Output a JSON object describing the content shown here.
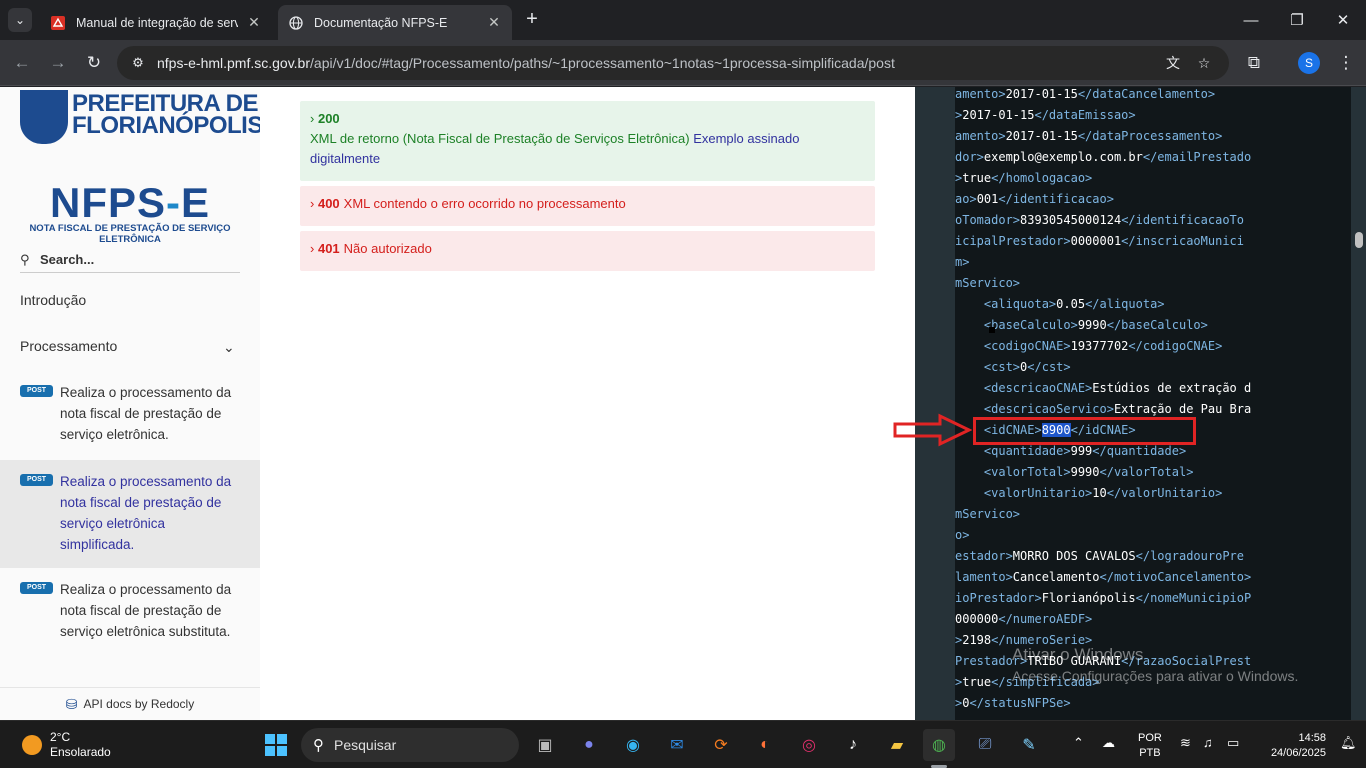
{
  "browser": {
    "tabs": [
      {
        "title": "Manual de integração de serviço",
        "icon": "pdf-icon"
      },
      {
        "title": "Documentação NFPS-E",
        "icon": "globe-icon"
      }
    ],
    "url_host": "nfps-e-hml.pmf.sc.gov.br",
    "url_path": "/api/v1/doc/#tag/Processamento/paths/~1processamento~1notas~1processa-simplificada/post",
    "profile_initial": "S"
  },
  "sidebar": {
    "logo_line1": "PREFEITURA DE",
    "logo_line2": "FLORIANÓPOLIS",
    "brand_a": "NFPS",
    "brand_dash": "-",
    "brand_b": "E",
    "brand_sub": "NOTA FISCAL DE PRESTAÇÃO DE SERVIÇO ELETRÔNICA",
    "search_placeholder": "Search...",
    "menu": [
      "Introdução",
      "Processamento"
    ],
    "operations": [
      {
        "method": "POST",
        "label": "Realiza o processamento da nota fiscal de prestação de serviço eletrônica."
      },
      {
        "method": "POST",
        "label": "Realiza o processamento da nota fiscal de prestação de serviço eletrônica simplificada."
      },
      {
        "method": "POST",
        "label": "Realiza o processamento da nota fiscal de prestação de serviço eletrônica substituta."
      }
    ],
    "footer": "API docs by Redocly"
  },
  "responses": [
    {
      "code": "200",
      "desc": "XML de retorno (Nota Fiscal de Prestação de Serviços Eletrônica)",
      "link": "Exemplo assinado digitalmente"
    },
    {
      "code": "400",
      "desc": "XML contendo o erro ocorrido no processamento"
    },
    {
      "code": "401",
      "desc": "Não autorizado"
    }
  ],
  "code_lines": [
    {
      "open": "amento>",
      "val": "2017-01-15",
      "close": "</dataCancelamento>"
    },
    {
      "open": ">",
      "val": "2017-01-15",
      "close": "</dataEmissao>"
    },
    {
      "open": "amento>",
      "val": "2017-01-15",
      "close": "</dataProcessamento>"
    },
    {
      "open": "dor>",
      "val": "exemplo@exemplo.com.br",
      "close": "</emailPrestado"
    },
    {
      "open": ">",
      "val": "true",
      "close": "</homologacao>"
    },
    {
      "open": "ao>",
      "val": "001",
      "close": "</identificacao>"
    },
    {
      "open": "oTomador>",
      "val": "83930545000124",
      "close": "</identificacaoTo"
    },
    {
      "open": "icipalPrestador>",
      "val": "0000001",
      "close": "</inscricaoMunici"
    },
    {
      "open": "m>",
      "val": "",
      "close": ""
    },
    {
      "open": "mServico>",
      "val": "",
      "close": ""
    },
    {
      "open": "    <aliquota>",
      "val": "0.05",
      "close": "</aliquota>"
    },
    {
      "open": "    <baseCalculo>",
      "val": "9990",
      "close": "</baseCalculo>"
    },
    {
      "open": "    <codigoCNAE>",
      "val": "19377702",
      "close": "</codigoCNAE>"
    },
    {
      "open": "    <cst>",
      "val": "0",
      "close": "</cst>"
    },
    {
      "open": "    <descricaoCNAE>",
      "val": "Estúdios de extração d",
      "close": ""
    },
    {
      "open": "    <descricaoServico>",
      "val": "Extração de Pau Bra",
      "close": ""
    },
    {
      "open": "    <idCNAE>",
      "val": "8900",
      "close": "</idCNAE>",
      "selected": true
    },
    {
      "open": "    <quantidade>",
      "val": "999",
      "close": "</quantidade>"
    },
    {
      "open": "    <valorTotal>",
      "val": "9990",
      "close": "</valorTotal>"
    },
    {
      "open": "    <valorUnitario>",
      "val": "10",
      "close": "</valorUnitario>"
    },
    {
      "open": "mServico>",
      "val": "",
      "close": ""
    },
    {
      "open": "o>",
      "val": "",
      "close": ""
    },
    {
      "open": "estador>",
      "val": "MORRO DOS CAVALOS",
      "close": "</logradouroPre"
    },
    {
      "open": "lamento>",
      "val": "Cancelamento",
      "close": "</motivoCancelamento>"
    },
    {
      "open": "ioPrestador>",
      "val": "Florianópolis",
      "close": "</nomeMunicipioP"
    },
    {
      "open": "",
      "val": "000000",
      "close": "</numeroAEDF>"
    },
    {
      "open": ">",
      "val": "2198",
      "close": "</numeroSerie>"
    },
    {
      "open": "Prestador>",
      "val": "TRIBO GUARANI",
      "close": "</razaoSocialPrest"
    },
    {
      "open": ">",
      "val": "true",
      "close": "</simplificada>"
    },
    {
      "open": ">",
      "val": "0",
      "close": "</statusNFPSe>"
    }
  ],
  "watermark": {
    "title": "Ativar o Windows",
    "sub": "Acesse Configurações para ativar o Windows."
  },
  "taskbar": {
    "temp": "2°C",
    "weather": "Ensolarado",
    "search_placeholder": "Pesquisar",
    "lang1": "POR",
    "lang2": "PTB",
    "time": "14:58",
    "date": "24/06/2025"
  }
}
